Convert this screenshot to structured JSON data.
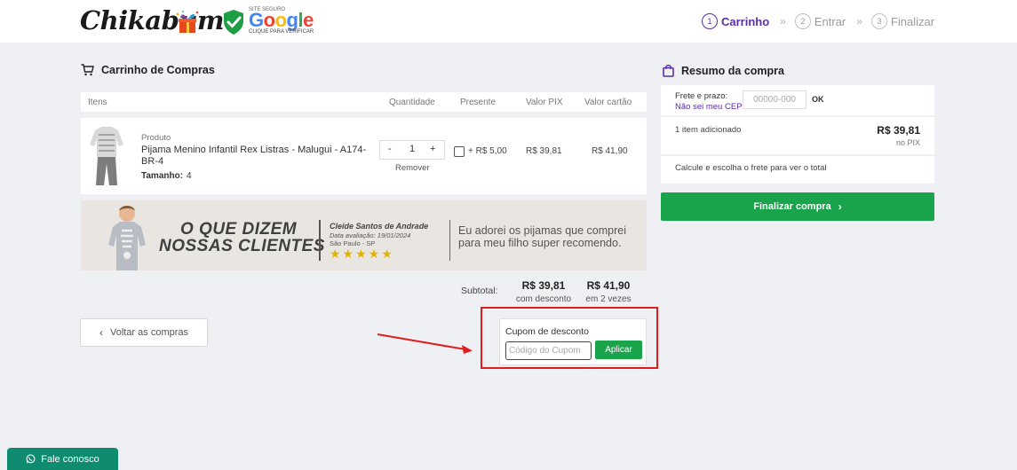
{
  "header": {
    "logo_text": "Chikabum",
    "seal": {
      "top_text": "SITE SEGURO",
      "brand": "Google",
      "bottom_text": "CLIQUE PARA VERIFICAR"
    },
    "steps": [
      {
        "num": "1",
        "label": "Carrinho",
        "active": true
      },
      {
        "num": "2",
        "label": "Entrar",
        "active": false
      },
      {
        "num": "3",
        "label": "Finalizar",
        "active": false
      }
    ],
    "step_separator": "»"
  },
  "cart": {
    "title": "Carrinho de Compras",
    "columns": {
      "items": "Itens",
      "quantity": "Quantidade",
      "gift": "Presente",
      "price_pix": "Valor PIX",
      "price_card": "Valor cartão"
    },
    "item": {
      "category": "Produto",
      "name": "Pijama Menino Infantil Rex Listras - Malugui - A174-BR-4",
      "size_label": "Tamanho:",
      "size_value": "4",
      "qty_minus": "-",
      "qty_value": "1",
      "qty_plus": "+",
      "remove": "Remover",
      "gift_label": "+ R$ 5,00",
      "price_pix": "R$ 39,81",
      "price_card": "R$ 41,90"
    },
    "banner": {
      "heading_line1": "O QUE DIZEM",
      "heading_line2": "NOSSAS CLIENTES",
      "reviewer": "Cleide Santos de Andrade",
      "date": "Data avaliação: 19/01/2024",
      "city": "São Paulo - SP",
      "stars": "★★★★★",
      "quote": "Eu adorei os pijamas que comprei para meu filho super recomendo."
    },
    "subtotal": {
      "label": "Subtotal:",
      "pix_value": "R$ 39,81",
      "pix_note": "com desconto",
      "card_value": "R$ 41,90",
      "card_note": "em 2 vezes"
    },
    "back_button": "Voltar as compras",
    "coupon": {
      "title": "Cupom de desconto",
      "placeholder": "Código do Cupom",
      "apply": "Aplicar"
    }
  },
  "summary": {
    "title": "Resumo da compra",
    "shipping_label": "Frete e prazo:",
    "cep_link": "Não sei meu CEP",
    "cep_placeholder": "00000-000",
    "cep_ok": "OK",
    "items_added": "1 item adicionado",
    "total": "R$ 39,81",
    "total_note": "no PIX",
    "calc_message": "Calcule e escolha o frete para ver o total",
    "finish_button": "Finalizar compra"
  },
  "contact": {
    "label": "Fale conosco"
  },
  "colors": {
    "brand_purple": "#5a2ea6",
    "cta_green": "#19a34a",
    "highlight_red": "#e01e1e",
    "contact_teal": "#0f8c6f"
  }
}
